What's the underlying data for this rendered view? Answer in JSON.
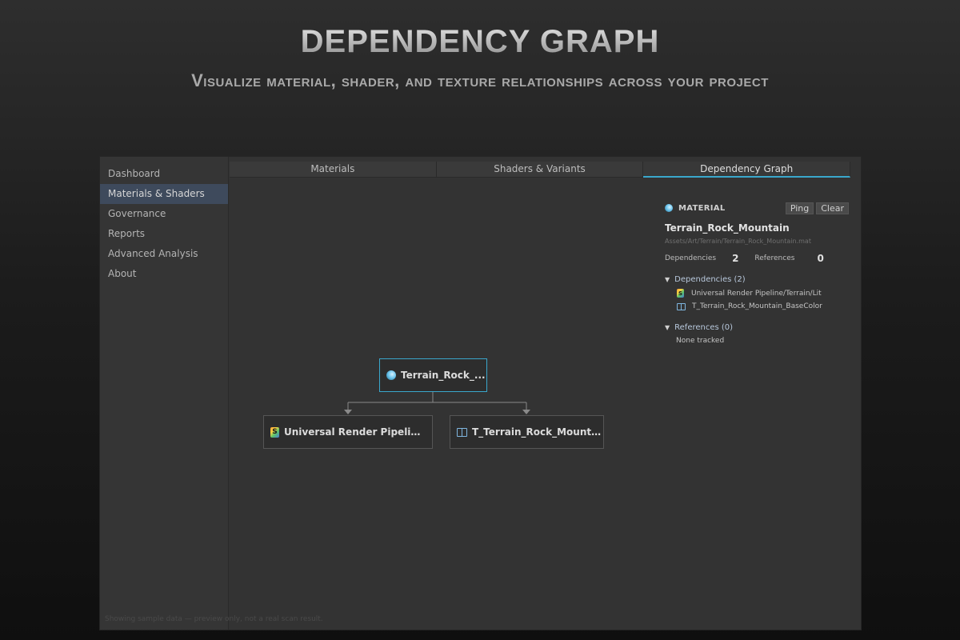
{
  "hero": {
    "title": "Dependency Graph",
    "subtitle": "Visualize material, shader, and texture relationships across your project"
  },
  "sidebar": {
    "items": [
      {
        "label": "Dashboard",
        "active": false
      },
      {
        "label": "Materials & Shaders",
        "active": true
      },
      {
        "label": "Governance",
        "active": false
      },
      {
        "label": "Reports",
        "active": false
      },
      {
        "label": "Advanced Analysis",
        "active": false
      },
      {
        "label": "About",
        "active": false
      }
    ]
  },
  "tabs": [
    {
      "label": "Materials",
      "active": false
    },
    {
      "label": "Shaders & Variants",
      "active": false
    },
    {
      "label": "Dependency Graph",
      "active": true
    }
  ],
  "graph": {
    "root": {
      "label": "Terrain_Rock_...",
      "icon": "material-sphere-icon"
    },
    "children": [
      {
        "label": "Universal Render Pipeline/T...",
        "icon": "shader-icon"
      },
      {
        "label": "T_Terrain_Rock_Mountai...",
        "icon": "texture-icon"
      }
    ]
  },
  "inspector": {
    "kind": "MATERIAL",
    "ping_label": "Ping",
    "clear_label": "Clear",
    "name": "Terrain_Rock_Mountain",
    "path": "Assets/Art/Terrain/Terrain_Rock_Mountain.mat",
    "dependencies_label": "Dependencies",
    "dependencies_count": "2",
    "references_label": "References",
    "references_count": "0",
    "dependencies_section": "Dependencies (2)",
    "dependencies": [
      {
        "label": "Universal Render Pipeline/Terrain/Lit",
        "icon": "shader-icon"
      },
      {
        "label": "T_Terrain_Rock_Mountain_BaseColor",
        "icon": "texture-icon"
      }
    ],
    "references_section": "References (0)",
    "references_empty": "None tracked"
  },
  "footer": {
    "note": "Showing sample data — preview only, not a real scan result."
  },
  "colors": {
    "accent": "#3aa7cc",
    "active_sidebar": "#3e4a5c"
  }
}
